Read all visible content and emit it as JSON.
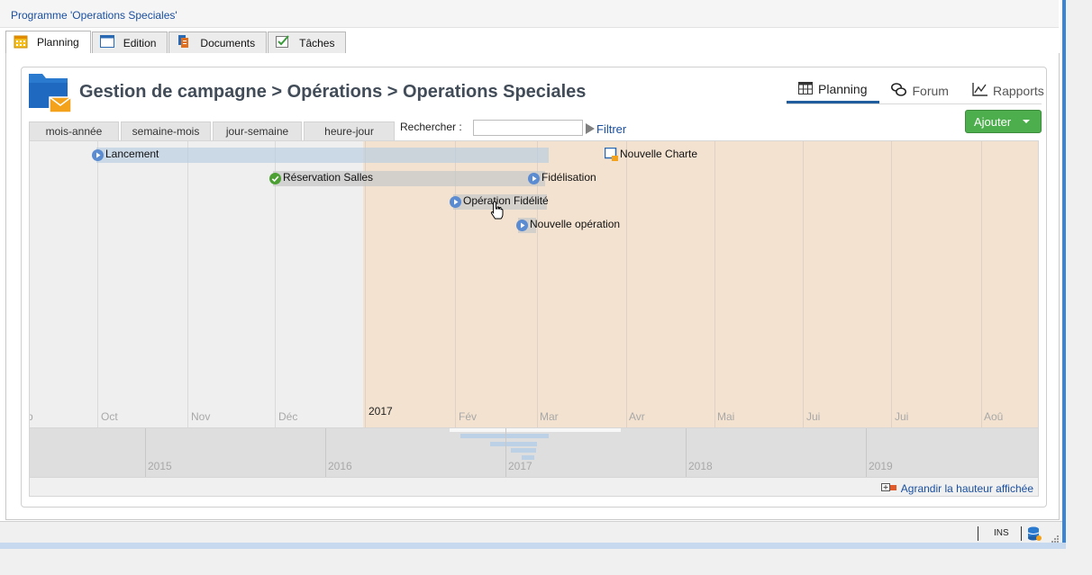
{
  "program_title": "Programme 'Operations Speciales'",
  "tabs": [
    {
      "label": "Planning",
      "icon": "calendar-icon",
      "active": true
    },
    {
      "label": "Edition",
      "icon": "window-icon",
      "active": false
    },
    {
      "label": "Documents",
      "icon": "documents-icon",
      "active": false
    },
    {
      "label": "Tâches",
      "icon": "checklist-icon",
      "active": false
    }
  ],
  "page_title": "Gestion de campagne > Opérations > Operations Speciales",
  "view_tabs": [
    {
      "label": "Planning",
      "icon": "calendar-grid-icon",
      "active": true
    },
    {
      "label": "Forum",
      "icon": "forum-icon",
      "active": false
    },
    {
      "label": "Rapports",
      "icon": "chart-line-icon",
      "active": false
    }
  ],
  "add_button": "Ajouter",
  "scale_tabs": [
    "mois-année",
    "semaine-mois",
    "jour-semaine",
    "heure-jour"
  ],
  "search": {
    "label": "Rechercher :",
    "value": "",
    "filter_label": "Filtrer"
  },
  "timeline": {
    "months": [
      "p",
      "Oct",
      "Nov",
      "Déc",
      "Fév",
      "Mar",
      "Avr",
      "Mai",
      "Jui",
      "Jui",
      "Aoû"
    ],
    "year_marker": "2017",
    "items": [
      {
        "label": "Lancement",
        "status": "planned"
      },
      {
        "label": "Réservation Salles",
        "status": "completed"
      },
      {
        "label": "Fidélisation",
        "status": "planned"
      },
      {
        "label": "Opération Fidélité",
        "status": "planned"
      },
      {
        "label": "Nouvelle opération",
        "status": "planned"
      },
      {
        "label": "Nouvelle Charte",
        "status": "document"
      }
    ]
  },
  "overview_years": [
    "2015",
    "2016",
    "2017",
    "2018",
    "2019"
  ],
  "grow_link": "Agrandir la hauteur affichée",
  "statusbar": {
    "mode": "INS"
  },
  "colors": {
    "link": "#1a4fa0",
    "accent_green": "#4cae4c",
    "future_zone": "#f3e2cf",
    "past_zone": "#efefef",
    "bar": "#c6d6e6",
    "bar_grey": "#d2d2d2",
    "planned_icon": "#5b8bd0",
    "completed_icon": "#4ca033"
  }
}
